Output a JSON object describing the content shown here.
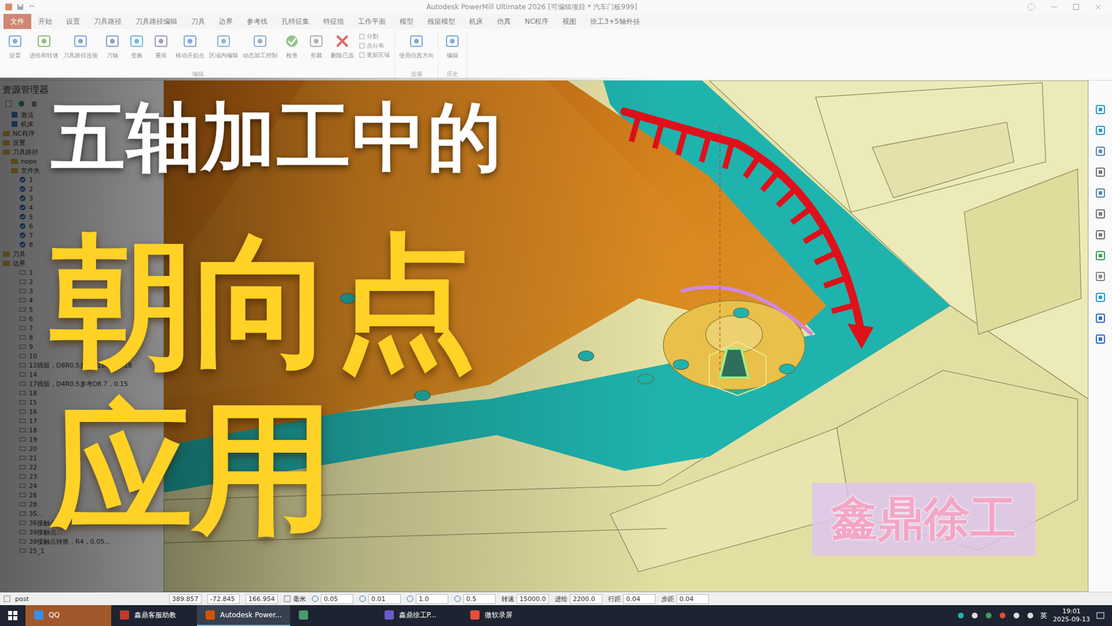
{
  "window": {
    "title": "Autodesk PowerMill Ultimate 2026  [可编辑项目 * 汽车门板999]"
  },
  "menu": [
    {
      "label": "文件",
      "selected": true
    },
    {
      "label": "开始",
      "selected": false
    },
    {
      "label": "设置",
      "selected": false
    },
    {
      "label": "刀具路径",
      "selected": false
    },
    {
      "label": "刀具路径编辑",
      "selected": false
    },
    {
      "label": "刀具",
      "selected": false
    },
    {
      "label": "边界",
      "selected": false
    },
    {
      "label": "参考线",
      "selected": false
    },
    {
      "label": "孔特征集",
      "selected": false
    },
    {
      "label": "特征组",
      "selected": false
    },
    {
      "label": "工作平面",
      "selected": false
    },
    {
      "label": "模型",
      "selected": false
    },
    {
      "label": "残留模型",
      "selected": false
    },
    {
      "label": "机床",
      "selected": false
    },
    {
      "label": "仿真",
      "selected": false
    },
    {
      "label": "NC程序",
      "selected": false
    },
    {
      "label": "视图",
      "selected": false
    },
    {
      "label": "徐工3+5轴外挂",
      "selected": false
    }
  ],
  "ribbon": {
    "groups": [
      {
        "label": "编辑",
        "buttons": [
          {
            "label": "设置",
            "kind": "tool"
          },
          {
            "label": "进给和转速",
            "kind": "tool"
          },
          {
            "label": "刀具路径连接",
            "kind": "tool"
          },
          {
            "label": "刀轴",
            "kind": "tool"
          },
          {
            "label": "变换",
            "kind": "tool"
          },
          {
            "label": "重排",
            "kind": "tool"
          },
          {
            "label": "移动开始点",
            "kind": "tool"
          },
          {
            "label": "区域内编辑",
            "kind": "tool"
          },
          {
            "label": "动态加工控制",
            "kind": "tool"
          },
          {
            "label": "检查",
            "kind": "check"
          },
          {
            "label": "剪裁",
            "kind": "tool"
          },
          {
            "label": "删除已选",
            "kind": "delete"
          }
        ],
        "small": [
          "分割",
          "点分布",
          "更新区域"
        ]
      },
      {
        "label": "选项",
        "buttons": [
          {
            "label": "使用仿真方向",
            "kind": "tool"
          }
        ],
        "small": []
      },
      {
        "label": "历史",
        "buttons": [
          {
            "label": "编辑",
            "kind": "tool"
          }
        ],
        "small": []
      }
    ]
  },
  "explorer": {
    "title": "资源管理器",
    "items": [
      {
        "label": "激活",
        "kind": "node",
        "depth": 1
      },
      {
        "label": "机床",
        "kind": "node",
        "depth": 1
      },
      {
        "label": "NC程序",
        "kind": "folder",
        "depth": 0
      },
      {
        "label": "设置",
        "kind": "folder",
        "depth": 0
      },
      {
        "label": "刀具路径",
        "kind": "folder",
        "depth": 0
      },
      {
        "label": "nopo",
        "kind": "folder",
        "depth": 1
      },
      {
        "label": "文件夹",
        "kind": "folder",
        "depth": 1
      },
      {
        "label": "1",
        "kind": "path",
        "depth": 2
      },
      {
        "label": "2",
        "kind": "path",
        "depth": 2
      },
      {
        "label": "3",
        "kind": "path",
        "depth": 2
      },
      {
        "label": "4",
        "kind": "path",
        "depth": 2
      },
      {
        "label": "5",
        "kind": "path",
        "depth": 2
      },
      {
        "label": "6",
        "kind": "path",
        "depth": 2
      },
      {
        "label": "7",
        "kind": "path",
        "depth": 2
      },
      {
        "label": "8",
        "kind": "path",
        "depth": 2
      },
      {
        "label": "刀具",
        "kind": "folder",
        "depth": 0
      },
      {
        "label": "边界",
        "kind": "folder",
        "depth": 0
      },
      {
        "label": "1",
        "kind": "item",
        "depth": 2
      },
      {
        "label": "2",
        "kind": "item",
        "depth": 2
      },
      {
        "label": "3",
        "kind": "item",
        "depth": 2
      },
      {
        "label": "4",
        "kind": "item",
        "depth": 2
      },
      {
        "label": "5",
        "kind": "item",
        "depth": 2
      },
      {
        "label": "6",
        "kind": "item",
        "depth": 2
      },
      {
        "label": "7",
        "kind": "item",
        "depth": 2
      },
      {
        "label": "8",
        "kind": "item",
        "depth": 2
      },
      {
        "label": "9",
        "kind": "item",
        "depth": 2
      },
      {
        "label": "10",
        "kind": "item",
        "depth": 2
      },
      {
        "label": "12残留，D8R0.5参考D18.7，0.18",
        "kind": "item",
        "depth": 2
      },
      {
        "label": "14",
        "kind": "item",
        "depth": 2
      },
      {
        "label": "17残留，D4R0.5参考D8.7，0.15",
        "kind": "item",
        "depth": 2
      },
      {
        "label": "18",
        "kind": "item",
        "depth": 2
      },
      {
        "label": "15",
        "kind": "item",
        "depth": 2
      },
      {
        "label": "16",
        "kind": "item",
        "depth": 2
      },
      {
        "label": "17",
        "kind": "item",
        "depth": 2
      },
      {
        "label": "18",
        "kind": "item",
        "depth": 2
      },
      {
        "label": "19",
        "kind": "item",
        "depth": 2
      },
      {
        "label": "20",
        "kind": "item",
        "depth": 2
      },
      {
        "label": "21",
        "kind": "item",
        "depth": 2
      },
      {
        "label": "22",
        "kind": "item",
        "depth": 2
      },
      {
        "label": "23",
        "kind": "item",
        "depth": 2
      },
      {
        "label": "24",
        "kind": "item",
        "depth": 2
      },
      {
        "label": "26",
        "kind": "item",
        "depth": 2
      },
      {
        "label": "28",
        "kind": "item",
        "depth": 2
      },
      {
        "label": "35...",
        "kind": "item",
        "depth": 2
      },
      {
        "label": "36接触点...",
        "kind": "item",
        "depth": 2
      },
      {
        "label": "39接触点...",
        "kind": "item",
        "depth": 2
      },
      {
        "label": "39接触点转换，R4，0.05...",
        "kind": "item",
        "depth": 2
      },
      {
        "label": "25_1",
        "kind": "item",
        "depth": 2
      }
    ]
  },
  "overlay": {
    "line1": "五轴加工中的",
    "line2": "朝向点",
    "line3": "应用",
    "watermark": "鑫鼎徐工"
  },
  "status_bar": {
    "post": "post",
    "coords": [
      "389.857",
      "-72.845",
      "166.954"
    ],
    "unit": "毫米",
    "fields": [
      "0.05",
      "0.01",
      "1.0",
      "0.5"
    ],
    "labeled": [
      {
        "label": "转速",
        "value": "15000.0"
      },
      {
        "label": "进给",
        "value": "2200.0"
      },
      {
        "label": "行距",
        "value": "0.04"
      },
      {
        "label": "步距",
        "value": "0.04"
      }
    ]
  },
  "taskbar": {
    "apps": [
      {
        "label": "QQ",
        "selected": false,
        "flashing": true
      },
      {
        "label": "鑫鼎客服助教",
        "selected": false,
        "flashing": false
      },
      {
        "label": "Autodesk Power...",
        "selected": true,
        "flashing": false
      },
      {
        "label": "",
        "selected": false,
        "flashing": false
      },
      {
        "label": "鑫鼎徐工P...",
        "selected": false,
        "flashing": false
      },
      {
        "label": "微软录屏",
        "selected": false,
        "flashing": false
      }
    ],
    "ime": "英",
    "time": "19:01",
    "date": "2025-09-13"
  }
}
